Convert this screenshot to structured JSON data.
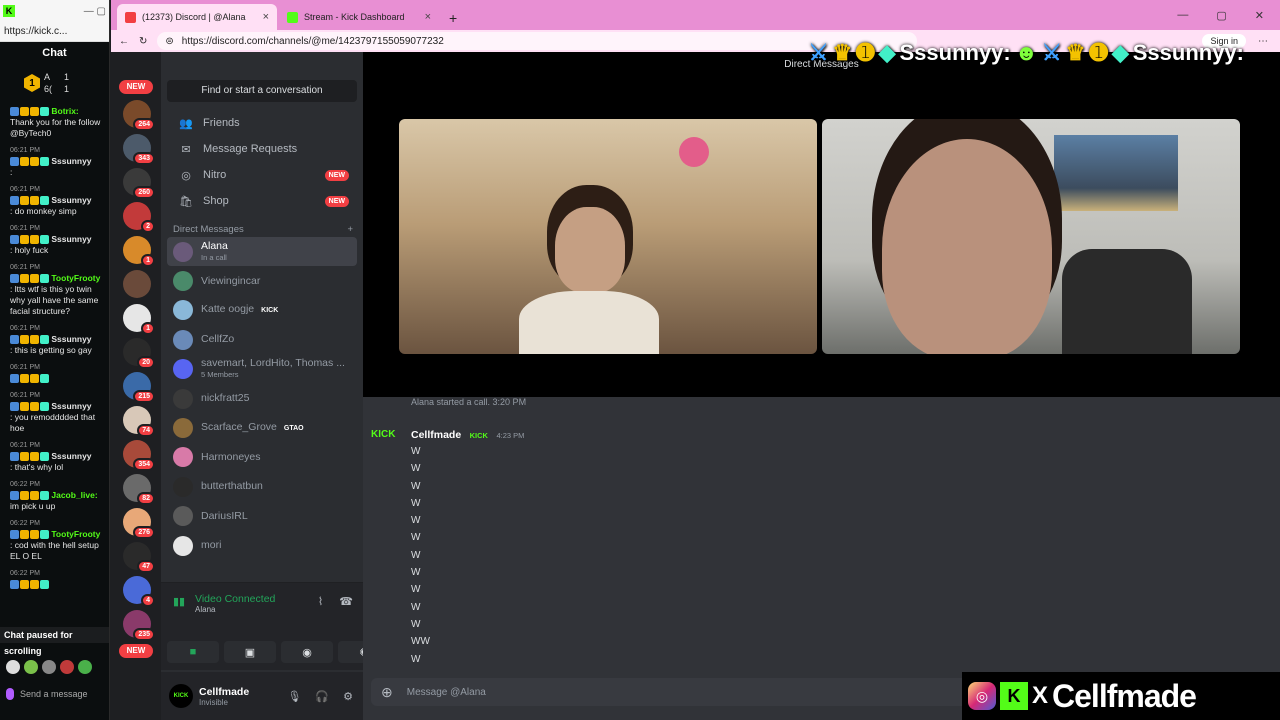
{
  "kick": {
    "url": "https://kick.c...",
    "chat_title": "Chat",
    "stats": {
      "level": "1",
      "a": "A",
      "sixty": "6(",
      "c1": "1",
      "c2": "1"
    },
    "messages": [
      {
        "time": "",
        "user": "Botrix:",
        "user_color": "#53fc18",
        "text": "Thank you for the follow @ByTech0"
      },
      {
        "time": "06:21 PM",
        "user": "Sssunnyy",
        "user_color": "#e6e6e6",
        "text": ":"
      },
      {
        "time": "06:21 PM",
        "user": "Sssunnyy",
        "user_color": "#e6e6e6",
        "text": ": do monkey simp"
      },
      {
        "time": "06:21 PM",
        "user": "Sssunnyy",
        "user_color": "#e6e6e6",
        "text": ": holy fuck"
      },
      {
        "time": "06:21 PM",
        "user": "TootyFrooty",
        "user_color": "#53fc18",
        "text": ": ltts wtf is this yo twin why yall have the same facial structure?"
      },
      {
        "time": "06:21 PM",
        "user": "Sssunnyy",
        "user_color": "#e6e6e6",
        "text": ": this is getting so gay"
      },
      {
        "time": "06:21 PM",
        "user": "",
        "user_color": "#e6e6e6",
        "text": ""
      },
      {
        "time": "06:21 PM",
        "user": "Sssunnyy",
        "user_color": "#e6e6e6",
        "text": ": you remodddded that hoe"
      },
      {
        "time": "06:21 PM",
        "user": "Sssunnyy",
        "user_color": "#e6e6e6",
        "text": ": that's why lol"
      },
      {
        "time": "06:22 PM",
        "user": "Jacob_live:",
        "user_color": "#53fc18",
        "text": "im pick u up"
      },
      {
        "time": "06:22 PM",
        "user": "TootyFrooty",
        "user_color": "#53fc18",
        "text": ": cod with the hell setup EL O EL"
      },
      {
        "time": "06:22 PM",
        "user": "",
        "user_color": "#e6e6e6",
        "text": ""
      }
    ],
    "paused": "Chat paused for scrolling",
    "send_placeholder": "Send a message"
  },
  "browser": {
    "tabs": [
      {
        "label": "(12373) Discord | @Alana",
        "color": "#f23f43"
      },
      {
        "label": "Stream - Kick Dashboard",
        "color": "#53fc18"
      }
    ],
    "url": "https://discord.com/channels/@me/1423797155059077232",
    "signin": "Sign in"
  },
  "discord": {
    "servers": [
      {
        "badge": "NEW",
        "color": ""
      },
      {
        "badge": "264",
        "color": "#7a4a2a"
      },
      {
        "badge": "343",
        "color": "#4c5a6a"
      },
      {
        "badge": "260",
        "color": "#3a3a3a"
      },
      {
        "badge": "2",
        "color": "#c23a3a"
      },
      {
        "badge": "1",
        "color": "#d88a2a"
      },
      {
        "badge": "",
        "color": "#6a4a3a"
      },
      {
        "badge": "1",
        "color": "#e6e6e6"
      },
      {
        "badge": "20",
        "color": "#2a2a2a"
      },
      {
        "badge": "215",
        "color": "#3a6aa8"
      },
      {
        "badge": "74",
        "color": "#d8c8b8"
      },
      {
        "badge": "354",
        "color": "#a84a3a"
      },
      {
        "badge": "82",
        "color": "#6a6a6a"
      },
      {
        "badge": "276",
        "color": "#e8a878"
      },
      {
        "badge": "47",
        "color": "#2a2a2a"
      },
      {
        "badge": "4",
        "color": "#4a6ad8"
      },
      {
        "badge": "235",
        "color": "#8a3a6a"
      }
    ],
    "find": "Find or start a conversation",
    "nav": [
      {
        "icon": "👥",
        "label": "Friends",
        "new": ""
      },
      {
        "icon": "✉",
        "label": "Message Requests",
        "new": ""
      },
      {
        "icon": "◎",
        "label": "Nitro",
        "new": "NEW"
      },
      {
        "icon": "🛍",
        "label": "Shop",
        "new": "NEW"
      }
    ],
    "dm_header": "Direct Messages",
    "dm_add": "+",
    "dms": [
      {
        "name": "Alana",
        "sub": "In a call",
        "tag": "",
        "color": "#6a5a7a"
      },
      {
        "name": "Viewingincar",
        "sub": "",
        "tag": "",
        "color": "#4a8a6a"
      },
      {
        "name": "Katte oogje",
        "sub": "",
        "tag": "KICK",
        "color": "#8ab8d8"
      },
      {
        "name": "CellfZo",
        "sub": "",
        "tag": "",
        "color": "#6a8ab8"
      },
      {
        "name": "savemart, LordHito, Thomas ...",
        "sub": "5 Members",
        "tag": "",
        "color": "#5865f2"
      },
      {
        "name": "nickfratt25",
        "sub": "",
        "tag": "",
        "color": "#3a3a3a"
      },
      {
        "name": "Scarface_Grove",
        "sub": "",
        "tag": "GTAO",
        "color": "#8a6a3a"
      },
      {
        "name": "Harmoneyes",
        "sub": "",
        "tag": "",
        "color": "#d87aa8"
      },
      {
        "name": "butterthatbun",
        "sub": "",
        "tag": "",
        "color": "#2a2a2a"
      },
      {
        "name": "DariusIRL",
        "sub": "",
        "tag": "",
        "color": "#5a5a5a"
      },
      {
        "name": "mori",
        "sub": "",
        "tag": "",
        "color": "#e6e6e6"
      }
    ],
    "voice": {
      "status": "Video Connected",
      "channel": "Alana"
    },
    "user": {
      "name": "Cellfmade",
      "status": "Invisible",
      "avatar_text": "KICK"
    },
    "call_header": "Direct Messages",
    "call_log": "Alana started a call. 3:20 PM",
    "message": {
      "author": "Cellfmade",
      "tag": "KICK",
      "time": "4:23 PM",
      "avatar_text": "KICK",
      "lines": [
        "W",
        "W",
        "W",
        "W",
        "W",
        "W",
        "W",
        "W",
        "W",
        "W",
        "W",
        "WW",
        "W"
      ]
    },
    "composer_placeholder": "Message @Alana"
  },
  "overlay": {
    "banner": "Sssunnyy:",
    "brand": "Cellfmade"
  }
}
